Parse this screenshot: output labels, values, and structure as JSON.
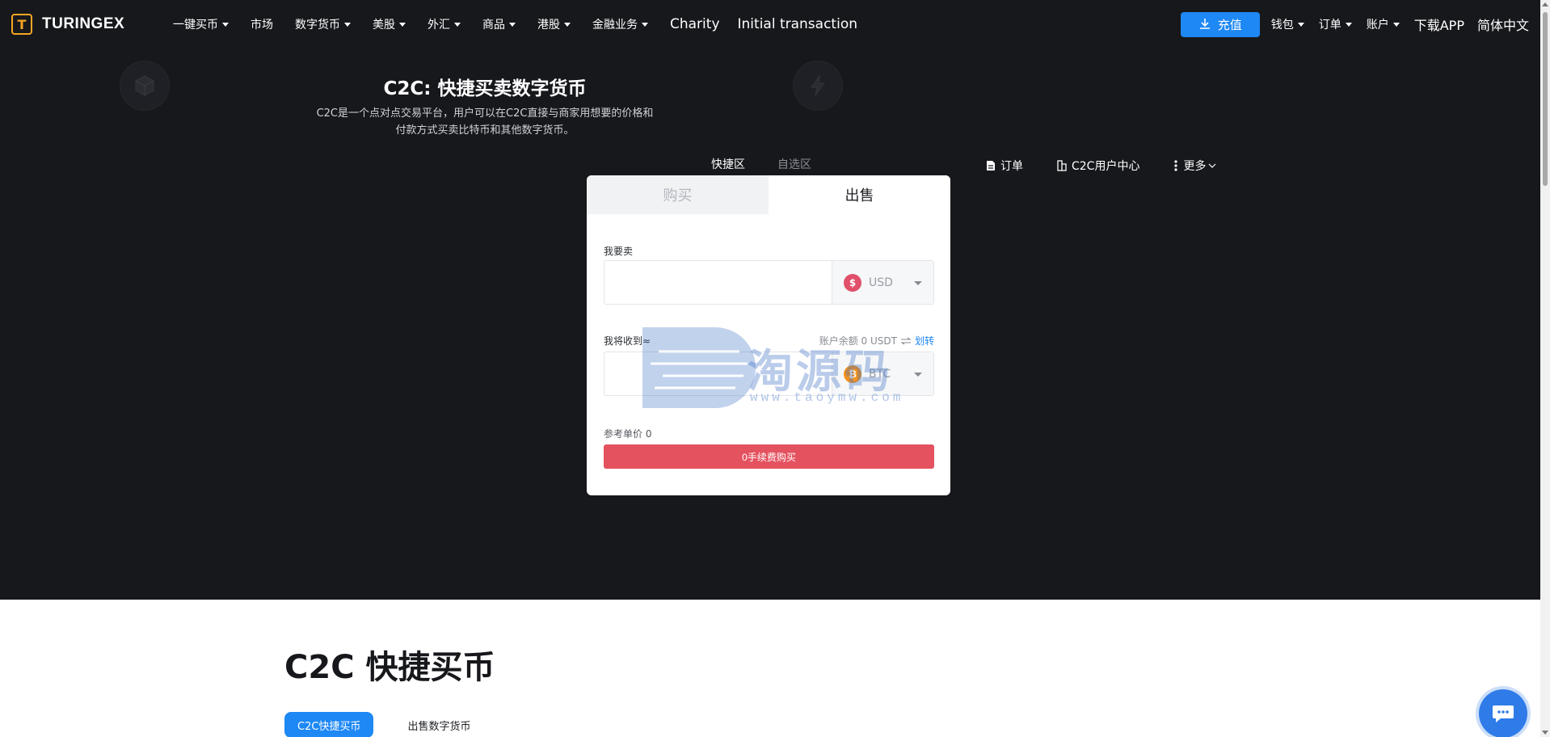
{
  "colors": {
    "nav_bg": "#17181c",
    "accent": "#1e88f5",
    "buy": "#e4525f",
    "usd": "#e0506a",
    "btc": "#f7931a"
  },
  "brand": {
    "name": "TURINGEX",
    "mark": "T"
  },
  "nav": {
    "items": [
      {
        "label": "一键买币",
        "dropdown": true
      },
      {
        "label": "市场",
        "dropdown": false
      },
      {
        "label": "数字货币",
        "dropdown": true
      },
      {
        "label": "美股",
        "dropdown": true
      },
      {
        "label": "外汇",
        "dropdown": true
      },
      {
        "label": "商品",
        "dropdown": true
      },
      {
        "label": "港股",
        "dropdown": true
      },
      {
        "label": "金融业务",
        "dropdown": true
      },
      {
        "label": "Charity",
        "dropdown": false
      },
      {
        "label": "Initial transaction",
        "dropdown": false
      }
    ],
    "deposit_label": "充值",
    "right": {
      "wallet": "钱包",
      "orders": "订单",
      "account": "账户",
      "download": "下载APP",
      "language": "简体中文"
    }
  },
  "hero": {
    "title": "C2C: 快捷买卖数字货币",
    "desc_line1": "C2C是一个点对点交易平台，用户可以在C2C直接与商家用想要的价格和",
    "desc_line2": "付款方式买卖比特币和其他数字货币。",
    "tabs": {
      "quick": "快捷区",
      "optional": "自选区"
    },
    "links": {
      "orders": "订单",
      "user_center": "C2C用户中心",
      "more": "更多"
    }
  },
  "trade": {
    "tab_buy": "购买",
    "tab_sell": "出售",
    "sell_label": "我要卖",
    "sell_input": {
      "value": "",
      "placeholder": ""
    },
    "sell_currency": "USD",
    "sell_currency_symbol": "$",
    "receive_label": "我将收到≈",
    "balance": "账户余额 0 USDT",
    "transfer": "划转",
    "receive_input": {
      "value": "",
      "placeholder": ""
    },
    "receive_currency": "BTC",
    "receive_currency_symbol": "₿",
    "ref_price": "参考单价 0",
    "submit": "0手续费购买"
  },
  "watermark": {
    "text": "淘源码",
    "url": "www.taoymw.com"
  },
  "section": {
    "title": "C2C 快捷买币",
    "tabs": {
      "active": "C2C快捷买币",
      "other": "出售数字货币"
    }
  }
}
